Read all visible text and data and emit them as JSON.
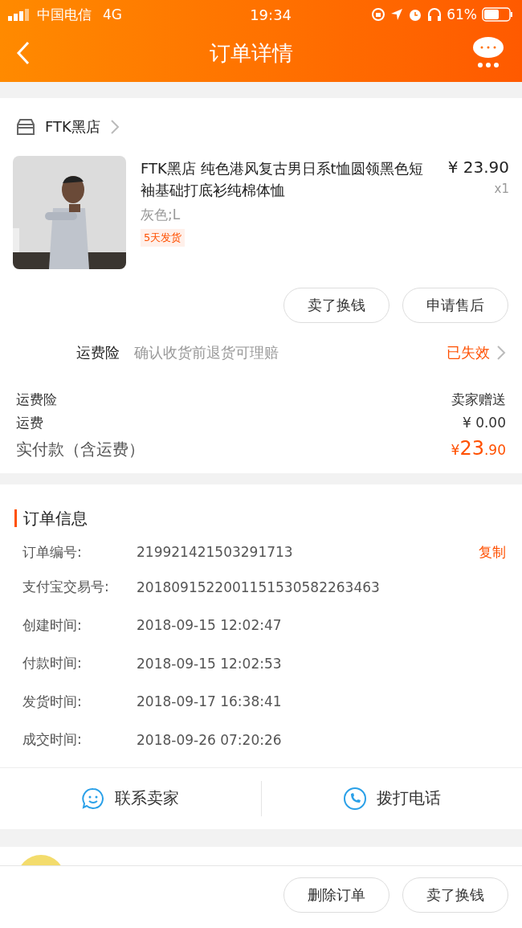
{
  "status_bar": {
    "carrier": "中国电信",
    "network": "4G",
    "time": "19:34",
    "battery": "61%"
  },
  "nav": {
    "title": "订单详情"
  },
  "shop": {
    "name": "FTK黑店"
  },
  "product": {
    "title": "FTK黑店 纯色港风复古男日系t恤圆领黑色短袖基础打底衫纯棉体恤",
    "price": "¥ 23.90",
    "quantity": "x1",
    "sku": "灰色;L",
    "tag": "5天发货"
  },
  "item_buttons": [
    "卖了换钱",
    "申请售后"
  ],
  "insurance": {
    "label": "运费险",
    "description": "确认收货前退货可理赔",
    "status": "已失效"
  },
  "summary": [
    {
      "label": "运费险",
      "value": "卖家赠送"
    },
    {
      "label": "运费",
      "value": "¥ 0.00"
    }
  ],
  "total": {
    "label": "实付款（含运费）",
    "currency": "¥",
    "integer": "23",
    "decimal": ".90"
  },
  "order_info": {
    "title": "订单信息",
    "copy": "复制",
    "rows": [
      {
        "label": "订单编号:",
        "value": "219921421503291713"
      },
      {
        "label": "支付宝交易号:",
        "value": "2018091522001151530582263463"
      },
      {
        "label": "创建时间:",
        "value": "2018-09-15 12:02:47"
      },
      {
        "label": "付款时间:",
        "value": "2018-09-15 12:02:53"
      },
      {
        "label": "发货时间:",
        "value": "2018-09-17 16:38:41"
      },
      {
        "label": "成交时间:",
        "value": "2018-09-26 07:20:26"
      }
    ]
  },
  "contact": [
    {
      "kind": "chat",
      "label": "联系卖家"
    },
    {
      "kind": "phone",
      "label": "拨打电话"
    }
  ],
  "bottom_buttons": [
    "删除订单",
    "卖了换钱"
  ]
}
